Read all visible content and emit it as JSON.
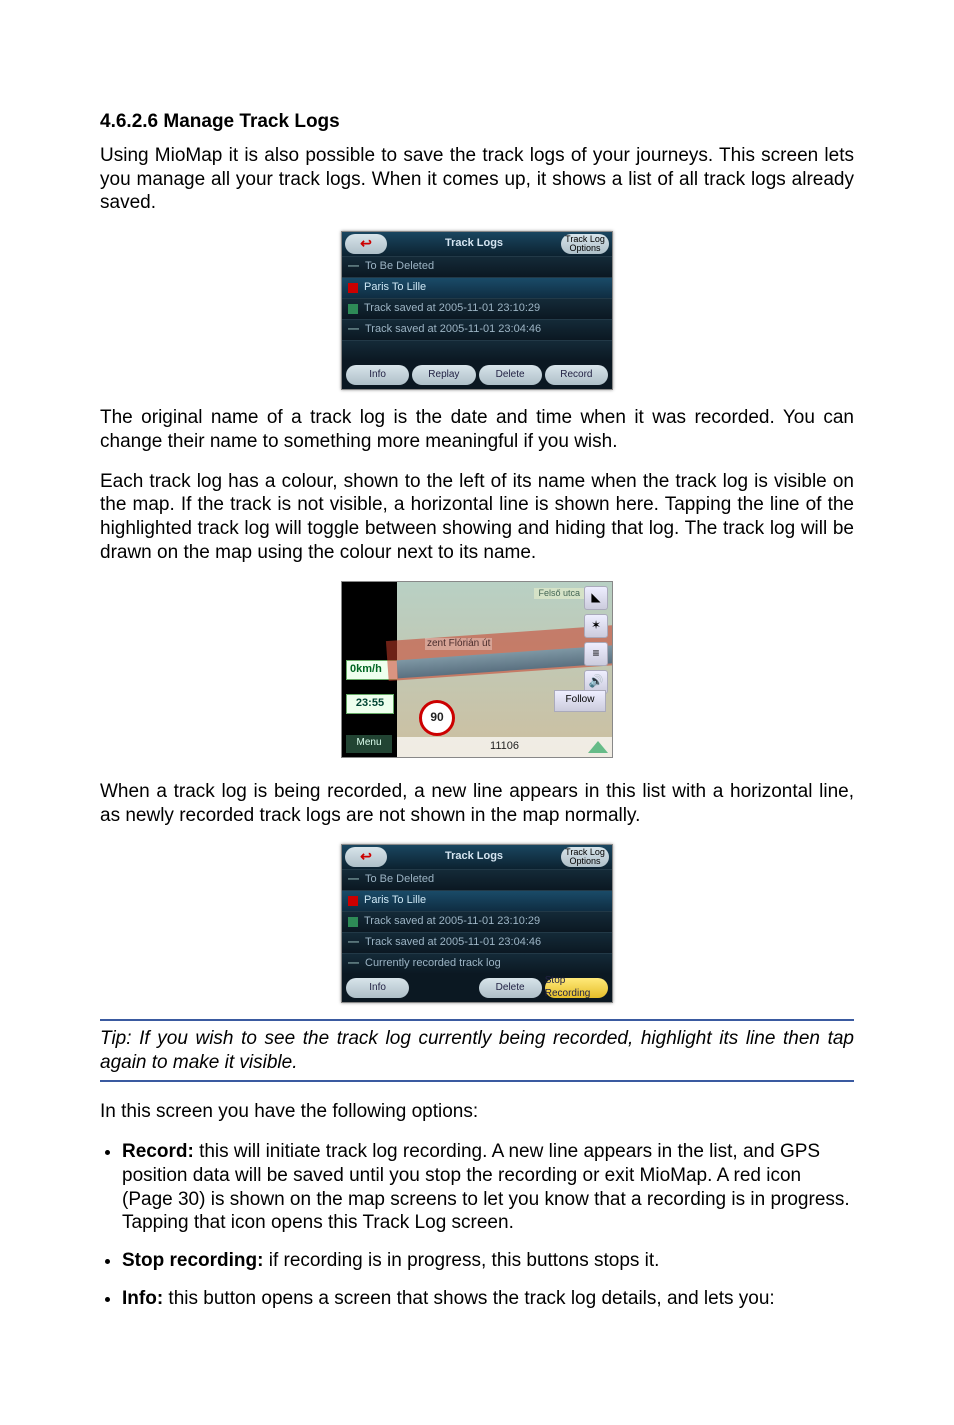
{
  "heading": "4.6.2.6  Manage Track Logs",
  "p1": "Using MioMap it is also possible to save the track logs of your journeys. This screen lets you manage all your track logs. When it comes up, it shows a list of all track logs already saved.",
  "p2": "The original name of a track log is the date and time when it was recorded. You can change their name to something more meaningful if you wish.",
  "p3": "Each track log has a colour, shown to the left of its name when the track log is visible on the map. If the track is not visible, a horizontal line is shown here. Tapping the line of the highlighted track log will toggle between showing and hiding that log. The track log will be drawn on the map using the colour next to its name.",
  "p4": "When a track log is being recorded, a new line appears in this list with a horizontal line, as newly recorded track logs are not shown in the map normally.",
  "tip": "Tip: If you wish to see the track log currently being recorded, highlight its line then tap again to make it visible.",
  "p5": "In this screen you have the following options:",
  "bullets": {
    "b1_label": "Record:",
    "b1_text": " this will initiate track log recording. A new line appears in the list, and GPS position data will be saved until you stop the recording or exit MioMap. A red icon (Page 30) is shown on the map screens to let you know that a recording is in progress. Tapping that icon opens this Track Log screen.",
    "b2_label": "Stop recording:",
    "b2_text": " if recording is in progress, this buttons stops it.",
    "b3_label": "Info:",
    "b3_text": " this button opens a screen that shows the track log details, and lets you:"
  },
  "dev1": {
    "title": "Track Logs",
    "options": "Track Log Options",
    "rows": [
      "To Be Deleted",
      "Paris To Lille",
      "Track saved at 2005-11-01 23:10:29",
      "Track saved at 2005-11-01 23:04:46"
    ],
    "buttons": [
      "Info",
      "Replay",
      "Delete",
      "Record"
    ]
  },
  "dev2": {
    "title": "Track Logs",
    "options": "Track Log Options",
    "rows": [
      "To Be Deleted",
      "Paris To Lille",
      "Track saved at 2005-11-01 23:10:29",
      "Track saved at 2005-11-01 23:04:46",
      "Currently recorded track log"
    ],
    "buttons": {
      "info": "Info",
      "delete": "Delete",
      "stop": "Stop Recording"
    }
  },
  "map": {
    "street": "zent Flórián út",
    "top_label": "Felső utca",
    "speed": "0km/h",
    "time": "23:55",
    "menu": "Menu",
    "sign": "90",
    "follow": "Follow",
    "dist": "11106"
  }
}
